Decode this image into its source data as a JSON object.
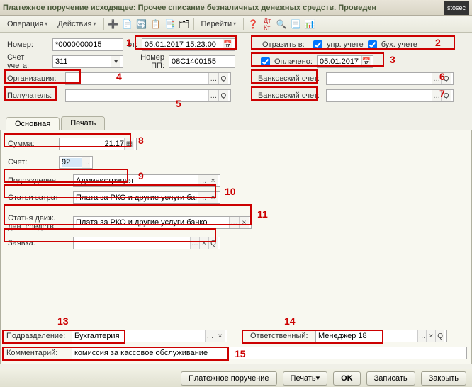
{
  "title": "Платежное поручение исходящее: Прочее списание безналичных денежных средств. Проведен",
  "logo": "stosec",
  "toolbar": {
    "operation": "Операция",
    "actions": "Действия",
    "goto": "Перейти"
  },
  "header": {
    "number_label": "Номер:",
    "number_value": "*0000000015",
    "date_label": "от:",
    "date_value": "05.01.2017 15:23:00",
    "account_label": "Счет учета:",
    "account_value": "311",
    "pp_label": "Номер ПП:",
    "pp_value": "08C1400155",
    "reflect_label": "Отразить в:",
    "upr_label": "упр. учете",
    "buh_label": "бух. учете",
    "paid_label": "Оплачено:",
    "paid_date": "05.01.2017",
    "org_label": "Организация:",
    "org_value": "",
    "bank1_label": "Банковский счет:",
    "bank1_value": "",
    "recipient_label": "Получатель:",
    "recipient_value": "",
    "bank2_label": "Банковский счет:",
    "bank2_value": ""
  },
  "tabs": {
    "main": "Основная",
    "print": "Печать"
  },
  "mainTab": {
    "sum_label": "Сумма:",
    "sum_value": "21,17",
    "schet_label": "Счет:",
    "schet_value": "92",
    "podrazd_label": "Подразделен...",
    "podrazd_value": "Администрация",
    "stati_label": "Статьи затрат",
    "stati_value": "Плата за РКО и другие услуги банко",
    "dvizh_label1": "Статья движ.",
    "dvizh_label2": "ден. средств:",
    "dvizh_value": "Плата за РКО и другие услуги банко",
    "zayavka_label": "Заявка:",
    "zayavka_value": ""
  },
  "footer": {
    "podrazd_label": "Подразделение:",
    "podrazd_value": "Бухгалтерия",
    "resp_label": "Ответственный:",
    "resp_value": "Менеджер 18",
    "comment_label": "Комментарий:",
    "comment_value": "комиссия за кассовое обслуживание"
  },
  "bottombar": {
    "po": "Платежное поручение",
    "print": "Печать",
    "ok": "OK",
    "write": "Записать",
    "close": "Закрыть"
  },
  "annotations": {
    "a1": "1",
    "a2": "2",
    "a3": "3",
    "a4": "4",
    "a5": "5",
    "a6": "6",
    "a7": "7",
    "a8": "8",
    "a9": "9",
    "a10": "10",
    "a11": "11",
    "a13": "13",
    "a14": "14",
    "a15": "15"
  }
}
